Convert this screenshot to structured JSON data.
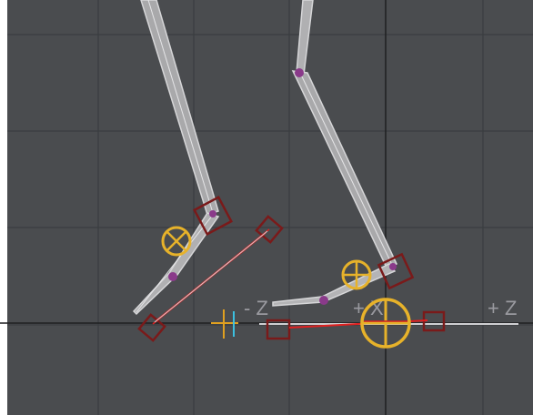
{
  "viewport": {
    "background": "#4a4c4f",
    "grid_color": "#3a3c3f",
    "axis_color": "#1e1f21",
    "bone_color": "#bdbdbd",
    "ik_goal_color": "#7a1a1a",
    "ik_link_color": "#e02020",
    "pivot_color": "#e7b22a",
    "joint_color": "#8a3a8a",
    "origin_color": "#e0a020",
    "axis_labels": {
      "minus_z": "- Z",
      "plus_x": "+ X",
      "plus_z": "+ Z"
    }
  }
}
